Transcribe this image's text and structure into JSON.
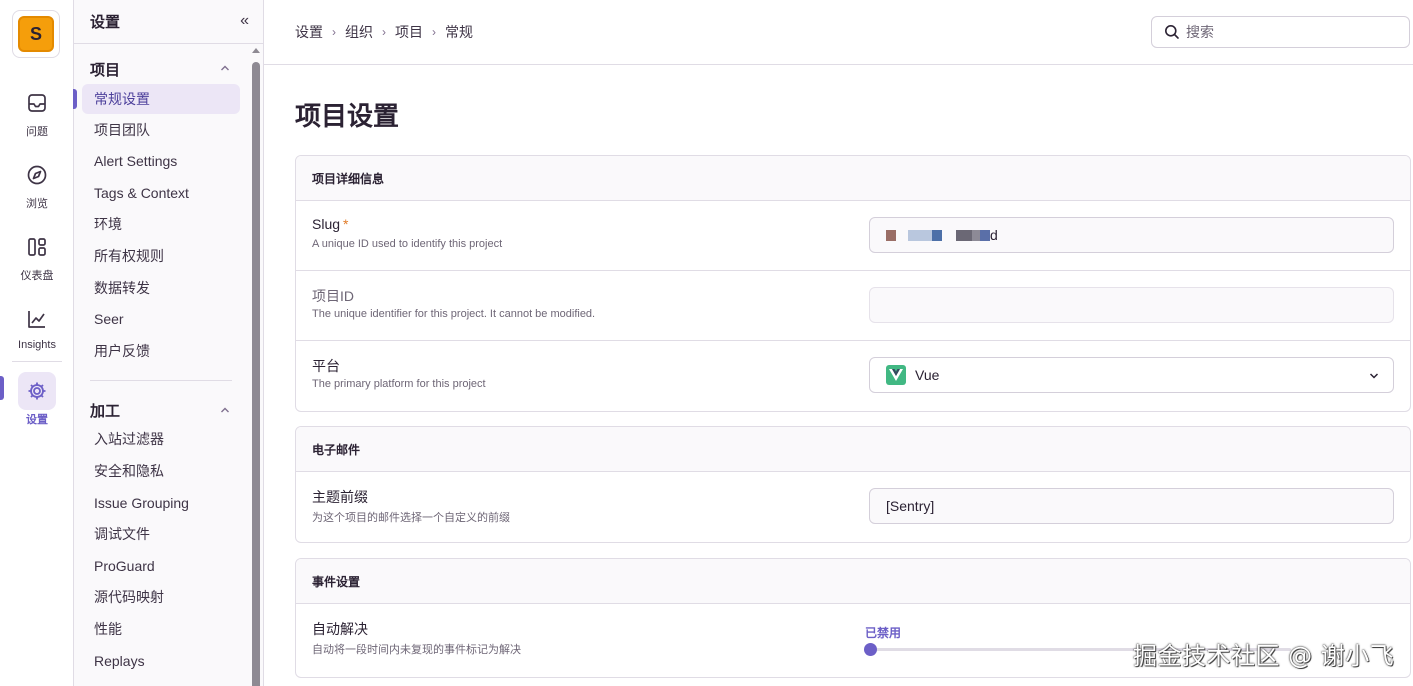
{
  "org": {
    "initial": "S"
  },
  "rail": {
    "items": [
      {
        "label": "问题",
        "icon": "inbox-icon"
      },
      {
        "label": "浏览",
        "icon": "compass-icon"
      },
      {
        "label": "仪表盘",
        "icon": "dashboard-icon"
      },
      {
        "label": "Insights",
        "icon": "chart-icon"
      },
      {
        "label": "设置",
        "icon": "gear-icon",
        "active": true
      }
    ]
  },
  "secnav": {
    "title": "设置",
    "collapse_glyph": "«",
    "project_section": {
      "title": "项目",
      "items": [
        "常规设置",
        "项目团队",
        "Alert Settings",
        "Tags & Context",
        "环境",
        "所有权规则",
        "数据转发",
        "Seer",
        "用户反馈"
      ]
    },
    "processing_section": {
      "title": "加工",
      "items": [
        "入站过滤器",
        "安全和隐私",
        "Issue Grouping",
        "调试文件",
        "ProGuard",
        "源代码映射",
        "性能",
        "Replays"
      ]
    }
  },
  "breadcrumb": [
    "设置",
    "组织",
    "项目",
    "常规"
  ],
  "search": {
    "placeholder": "搜索"
  },
  "page": {
    "title": "项目设置"
  },
  "details_panel": {
    "title": "项目详细信息",
    "slug": {
      "label": "Slug",
      "required_mark": "*",
      "help": "A unique ID used to identify this project",
      "value_tail": "d"
    },
    "project_id": {
      "label": "项目ID",
      "help": "The unique identifier for this project. It cannot be modified.",
      "value": ""
    },
    "platform": {
      "label": "平台",
      "help": "The primary platform for this project",
      "value": "Vue",
      "icon": "vue-logo-icon"
    }
  },
  "email_panel": {
    "title": "电子邮件",
    "subject_prefix": {
      "label": "主题前缀",
      "help": "为这个项目的邮件选择一个自定义的前缀",
      "value": "[Sentry]"
    }
  },
  "event_panel": {
    "title": "事件设置",
    "auto_resolve": {
      "label": "自动解决",
      "help": "自动将一段时间内未复现的事件标记为解决",
      "state": "已禁用",
      "level": 0
    }
  },
  "watermark": "掘金技术社区 @ 谢小飞",
  "colors": {
    "accent": "#6c5fc7",
    "org_avatar": "#f59e0b",
    "vue": "#41b883"
  }
}
